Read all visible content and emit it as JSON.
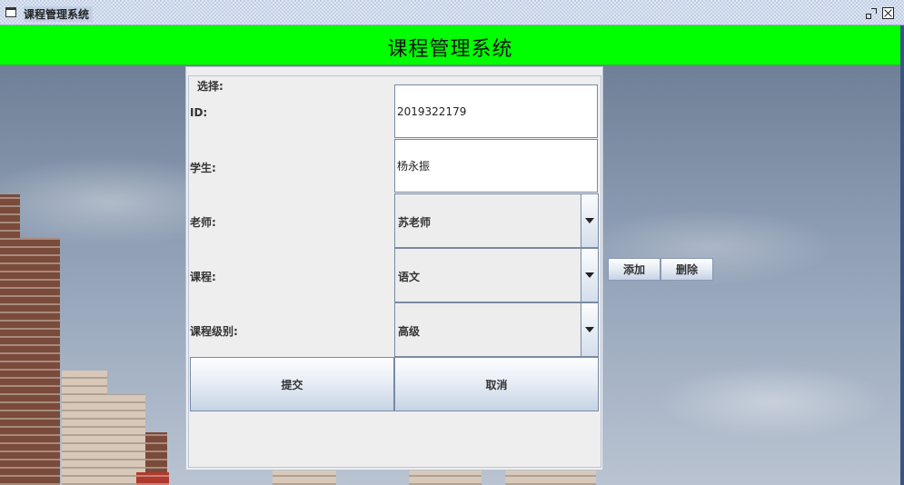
{
  "window": {
    "title": "课程管理系统",
    "restore_icon": "restore-icon",
    "close_icon": "close-icon"
  },
  "header": {
    "title": "课程管理系统",
    "background": "#00ff00"
  },
  "form": {
    "legend": "选择:",
    "id_label": "ID:",
    "id_value": "2019322179",
    "student_label": "学生:",
    "student_value": "杨永振",
    "teacher_label": "老师:",
    "teacher_value": "苏老师",
    "course_label": "课程:",
    "course_value": "语文",
    "level_label": "课程级别:",
    "level_value": "高级",
    "submit_label": "提交",
    "cancel_label": "取消"
  },
  "side_buttons": {
    "add_label": "添加",
    "delete_label": "删除"
  }
}
